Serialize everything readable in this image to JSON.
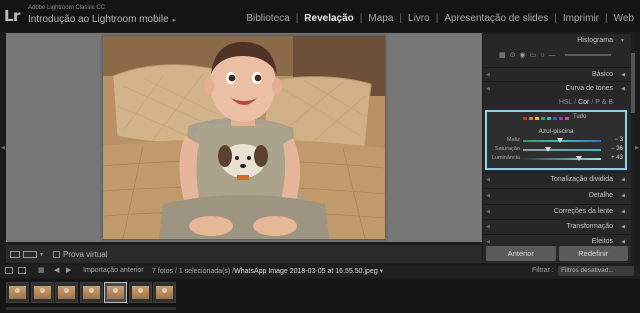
{
  "app": {
    "logo": "Lr",
    "name": "Adobe Lightroom Classic CC",
    "catalog": "Introdução ao Lightroom mobile",
    "catalog_arrow": "▸"
  },
  "modules": [
    {
      "label": "Biblioteca",
      "active": false
    },
    {
      "label": "Revelação",
      "active": true
    },
    {
      "label": "Mapa",
      "active": false
    },
    {
      "label": "Livro",
      "active": false
    },
    {
      "label": "Apresentação de slides",
      "active": false
    },
    {
      "label": "Imprimir",
      "active": false
    },
    {
      "label": "Web",
      "active": false
    }
  ],
  "toolbar": {
    "softproof_label": "Prova virtual"
  },
  "right_panel": {
    "histogram": "Histograma",
    "basic": "Básico",
    "tone_curve": "Curva de tones",
    "hsl_tabs": {
      "hsl": "HSL",
      "sep1": "/",
      "color": "Cor",
      "sep2": "/",
      "bw": "P & B"
    },
    "hsl": {
      "all_label": "Tudo",
      "group_title": "Azul-piscina",
      "swatch_colors": [
        "#c0392b",
        "#e67e22",
        "#f1c40f",
        "#27ae60",
        "#3fb6c8",
        "#2e62c9",
        "#8e44ad",
        "#c94fa0"
      ],
      "sliders": [
        {
          "label": "Matiz",
          "value": "− 3",
          "pos": 0.48,
          "track": "linear-gradient(90deg,#3a9a55,#3fb6c8,#3a6fc9)"
        },
        {
          "label": "Saturação",
          "value": "− 36",
          "pos": 0.32,
          "track": "linear-gradient(90deg,#9a9a9a,#3fb6c8)"
        },
        {
          "label": "Luminância",
          "value": "+ 43",
          "pos": 0.72,
          "track": "linear-gradient(90deg,#1e3e44,#9fe4f0)"
        }
      ]
    },
    "split_toning": "Tonalização dividida",
    "detail": "Detalhe",
    "lens_corrections": "Correções da lente",
    "transform": "Transformação",
    "effects": "Efeitos",
    "previous_button": "Anterior",
    "reset_button": "Redefinir"
  },
  "filmstrip_bar": {
    "source": "Importação anterior",
    "count": "7 fotos / 1 selecionada(s) /",
    "filename": "WhatsApp Image 2018-03-05 at 16.55.50.jpeg",
    "dropdown": "▾",
    "filter_label": "Filtrar :",
    "filter_value": "Filtros desativad..."
  },
  "filmstrip": {
    "count": 7,
    "selected_index": 4
  }
}
